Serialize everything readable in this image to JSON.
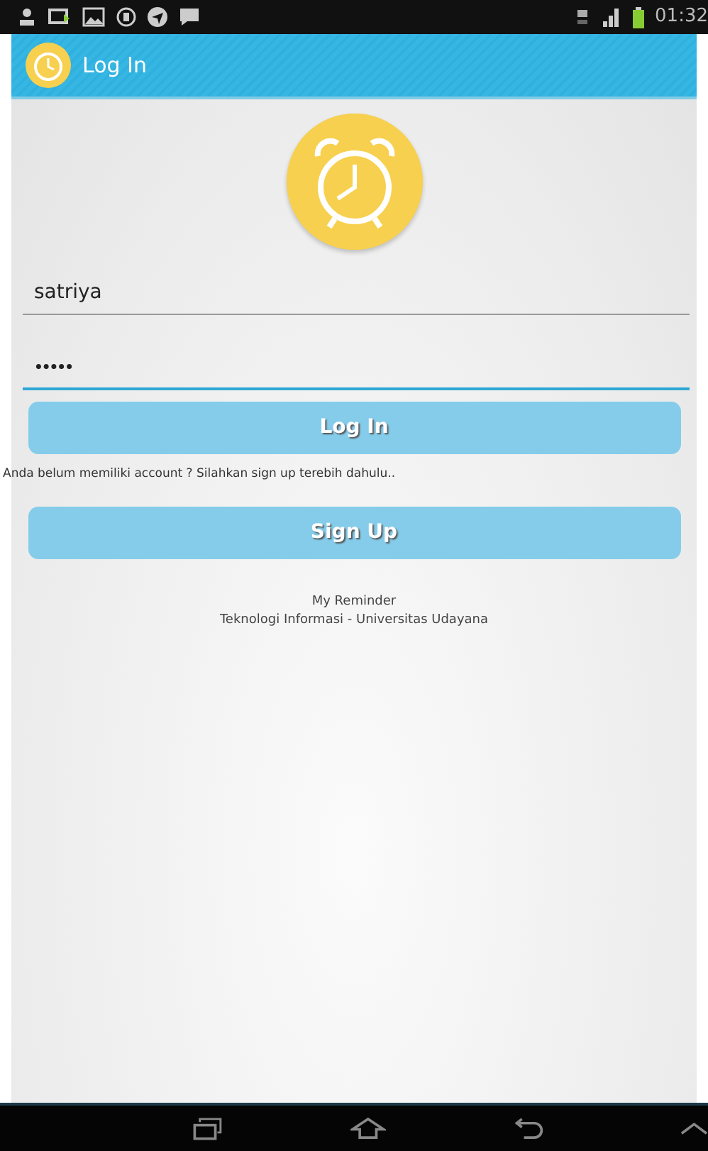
{
  "status_bar": {
    "time": "01:32"
  },
  "app_bar": {
    "title": "Log In"
  },
  "fields": [
    {
      "kind": "text",
      "value": "satriya",
      "focused": false
    },
    {
      "kind": "password",
      "value": "•••••",
      "focused": true
    }
  ],
  "login_button": "Log In",
  "signup_hint": "Anda belum memiliki account ? Silahkan sign up terebih dahulu..",
  "signup_button": "Sign Up",
  "footer": [
    "My Reminder",
    "Teknologi Informasi - Universitas Udayana"
  ]
}
